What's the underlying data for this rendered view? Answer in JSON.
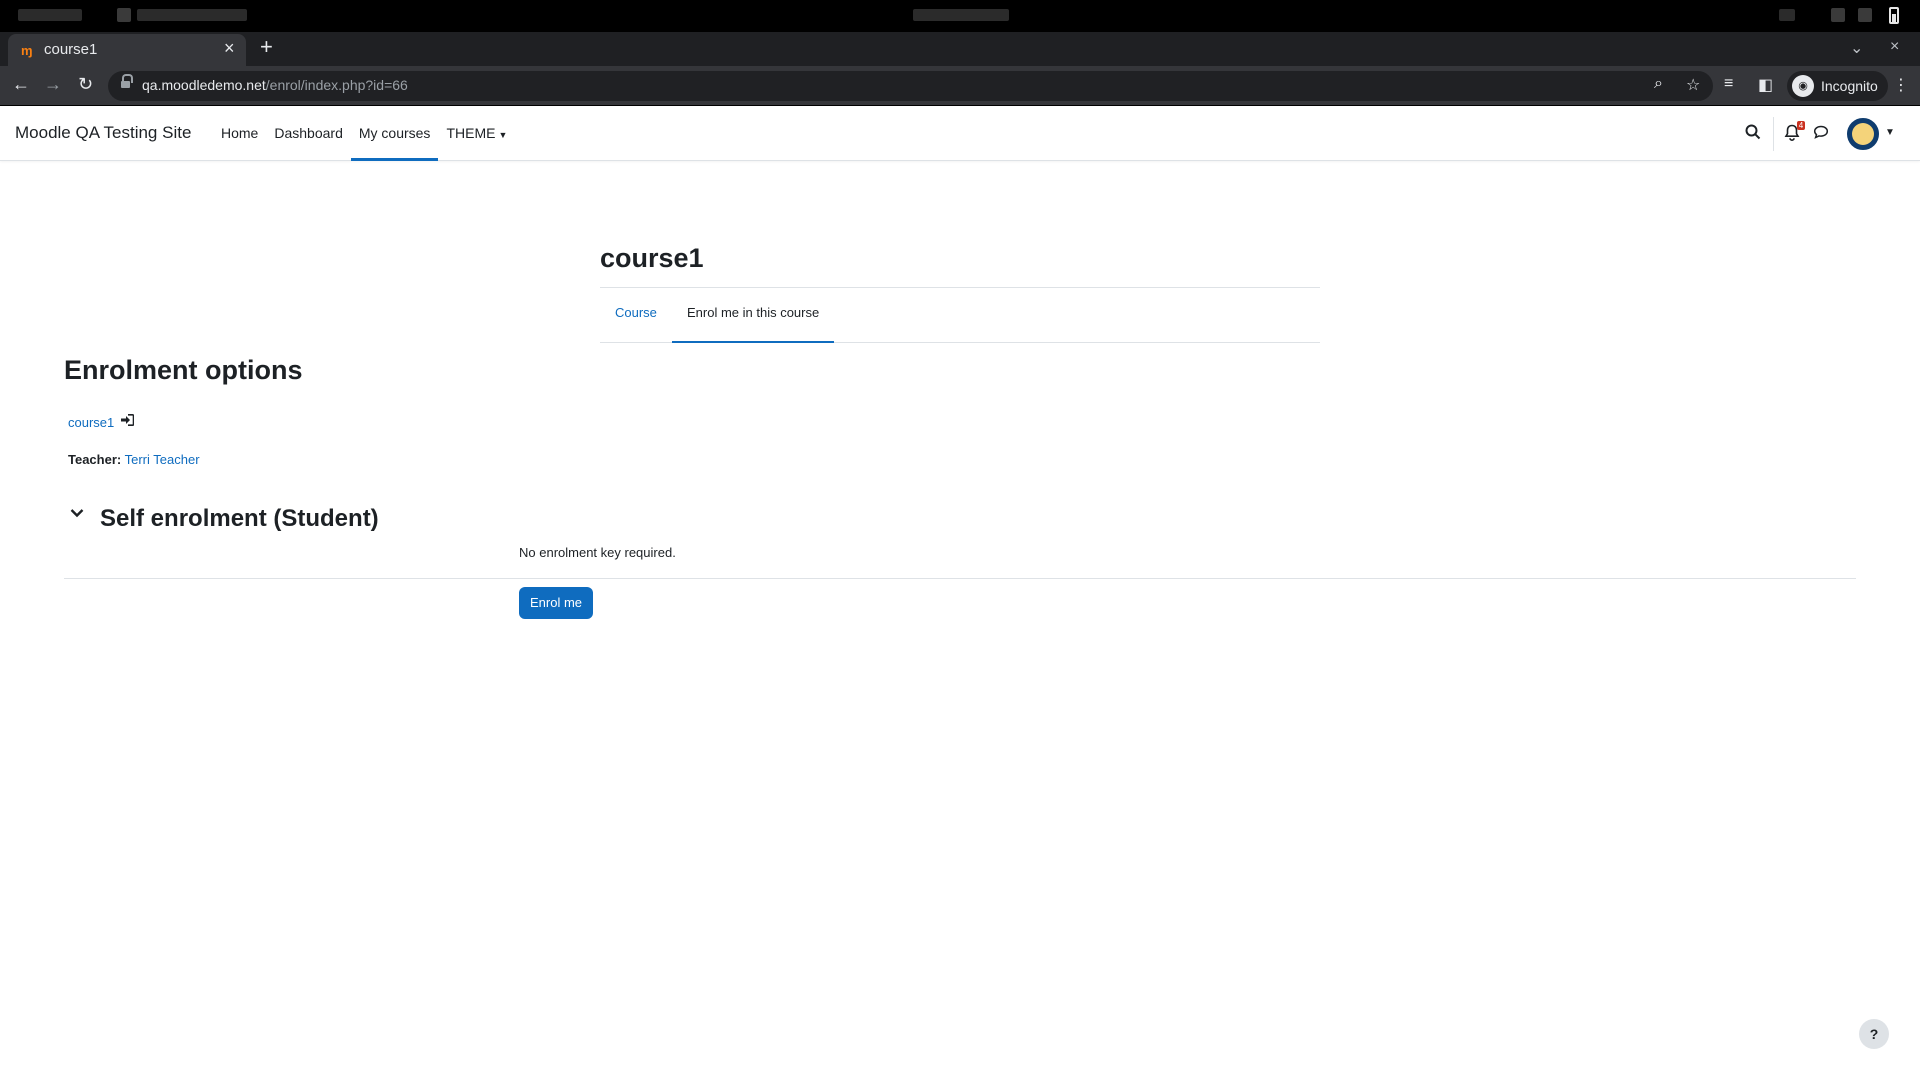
{
  "browser": {
    "tab_title": "course1",
    "tab_favicon": "moodle-favicon",
    "new_tab_label": "+",
    "url_host": "qa.moodledemo.net",
    "url_path": "/enrol/index.php?id=66",
    "incognito_label": "Incognito",
    "icons": [
      "back-arrow-icon",
      "forward-arrow-icon",
      "reload-icon",
      "lock-icon",
      "zoom-icon",
      "star-icon",
      "reading-list-icon",
      "sidebar-icon",
      "incognito-icon",
      "menu-dots-icon"
    ]
  },
  "navbar": {
    "brand": "Moodle QA Testing Site",
    "items": [
      {
        "label": "Home"
      },
      {
        "label": "Dashboard"
      },
      {
        "label": "My courses"
      },
      {
        "label": "THEME"
      }
    ],
    "active_item": "My courses",
    "notification_count": "4",
    "icons": [
      "search-icon",
      "bell-icon",
      "message-icon",
      "avatar",
      "chevron-down-icon"
    ]
  },
  "header": {
    "title": "course1",
    "tabs": [
      {
        "label": "Course"
      },
      {
        "label": "Enrol me in this course"
      }
    ],
    "active_tab": "Enrol me in this course"
  },
  "main": {
    "heading": "Enrolment options",
    "course_link": "course1",
    "teacher_label": "Teacher:",
    "teacher_name": "Terri Teacher",
    "self_enrolment_heading": "Self enrolment (Student)",
    "no_key_text": "No enrolment key required.",
    "enrol_button": "Enrol me"
  },
  "footer": {
    "help_label": "?"
  },
  "colors": {
    "accent": "#0f6cbf",
    "text": "#1d2125",
    "border": "#dee2e6",
    "badge": "#ca3120",
    "browser_dark": "#35363a"
  }
}
